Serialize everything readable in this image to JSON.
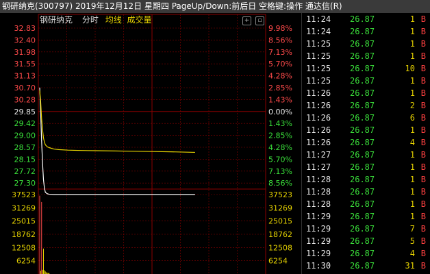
{
  "window": {
    "title": "钢研纳克(300797) 2019年12月12日 星期四 PageUp/Down:前后日 空格键:操作 通达信(R)"
  },
  "chart": {
    "stock_name": "钢研纳克",
    "mode_label": "分时",
    "avg_label": "均线",
    "volume_label": "成交量",
    "colors": {
      "up": "#ff4a4a",
      "down": "#3adf3a",
      "flat": "#e8e8e8",
      "price_line": "#ffffff",
      "avg_line": "#e6d200",
      "grid": "#8b0000"
    }
  },
  "chart_data": {
    "type": "line",
    "price_axis": {
      "left": [
        "32.83",
        "32.40",
        "31.98",
        "31.55",
        "31.13",
        "30.70",
        "30.28",
        "29.85",
        "29.42",
        "29.00",
        "28.57",
        "28.15",
        "27.72",
        "27.30"
      ],
      "right": [
        "9.98%",
        "8.56%",
        "7.13%",
        "5.70%",
        "4.28%",
        "2.85%",
        "1.43%",
        "0.00%",
        "1.43%",
        "2.85%",
        "4.28%",
        "5.70%",
        "7.13%",
        "8.56%"
      ],
      "ylim": [
        26.87,
        32.83
      ],
      "prev_close": 29.85
    },
    "volume_axis": {
      "left": [
        "37523",
        "31269",
        "25015",
        "18762",
        "12508",
        "6254"
      ],
      "right": [
        "37523",
        "31269",
        "25015",
        "18762",
        "12508",
        "6254"
      ],
      "ylim": [
        0,
        37523
      ]
    },
    "series": [
      {
        "name": "分时",
        "x": [
          0,
          1,
          2,
          3,
          4,
          5,
          6,
          8,
          10,
          15,
          20,
          30,
          40,
          60,
          80,
          100,
          120,
          140,
          165
        ],
        "values": [
          30.7,
          29.8,
          28.8,
          28.0,
          27.4,
          27.1,
          26.95,
          26.9,
          26.88,
          26.87,
          26.87,
          26.87,
          26.87,
          26.87,
          26.87,
          26.87,
          26.87,
          26.87,
          26.87
        ]
      },
      {
        "name": "均线",
        "x": [
          0,
          1,
          2,
          3,
          4,
          5,
          6,
          8,
          10,
          15,
          20,
          30,
          40,
          60,
          80,
          100,
          120,
          140,
          165
        ],
        "values": [
          30.6,
          30.2,
          29.6,
          29.2,
          28.9,
          28.75,
          28.65,
          28.58,
          28.55,
          28.5,
          28.48,
          28.46,
          28.45,
          28.44,
          28.43,
          28.42,
          28.41,
          28.4,
          28.38
        ]
      }
    ],
    "volume": {
      "x": [
        0,
        1,
        2,
        3,
        4,
        5,
        6,
        7,
        8,
        9,
        10
      ],
      "values": [
        37000,
        1500,
        34000,
        2000,
        12000,
        1800,
        1200,
        800,
        600,
        500,
        400
      ],
      "colors": [
        "#ff4a4a",
        "#e6d200",
        "#ff4a4a",
        "#e6d200",
        "#e6d200",
        "#e6d200",
        "#e6d200",
        "#e6d200",
        "#e6d200",
        "#e6d200",
        "#e6d200"
      ]
    },
    "session_minutes": 240
  },
  "trades": [
    {
      "time": "11:24",
      "price": "26.87",
      "vol": "1",
      "side": "B"
    },
    {
      "time": "11:24",
      "price": "26.87",
      "vol": "1",
      "side": "B"
    },
    {
      "time": "11:25",
      "price": "26.87",
      "vol": "1",
      "side": "B"
    },
    {
      "time": "11:25",
      "price": "26.87",
      "vol": "1",
      "side": "B"
    },
    {
      "time": "11:25",
      "price": "26.87",
      "vol": "10",
      "side": "B"
    },
    {
      "time": "11:25",
      "price": "26.87",
      "vol": "1",
      "side": "B"
    },
    {
      "time": "11:26",
      "price": "26.87",
      "vol": "1",
      "side": "B"
    },
    {
      "time": "11:26",
      "price": "26.87",
      "vol": "2",
      "side": "B"
    },
    {
      "time": "11:26",
      "price": "26.87",
      "vol": "6",
      "side": "B"
    },
    {
      "time": "11:26",
      "price": "26.87",
      "vol": "1",
      "side": "B"
    },
    {
      "time": "11:26",
      "price": "26.87",
      "vol": "4",
      "side": "B"
    },
    {
      "time": "11:27",
      "price": "26.87",
      "vol": "1",
      "side": "B"
    },
    {
      "time": "11:27",
      "price": "26.87",
      "vol": "1",
      "side": "B"
    },
    {
      "time": "11:28",
      "price": "26.87",
      "vol": "1",
      "side": "B"
    },
    {
      "time": "11:28",
      "price": "26.87",
      "vol": "1",
      "side": "B"
    },
    {
      "time": "11:28",
      "price": "26.87",
      "vol": "1",
      "side": "B"
    },
    {
      "time": "11:29",
      "price": "26.87",
      "vol": "1",
      "side": "B"
    },
    {
      "time": "11:29",
      "price": "26.87",
      "vol": "7",
      "side": "B"
    },
    {
      "time": "11:29",
      "price": "26.87",
      "vol": "5",
      "side": "B"
    },
    {
      "time": "11:29",
      "price": "26.87",
      "vol": "4",
      "side": "B"
    },
    {
      "time": "11:30",
      "price": "26.87",
      "vol": "31",
      "side": "B"
    }
  ]
}
